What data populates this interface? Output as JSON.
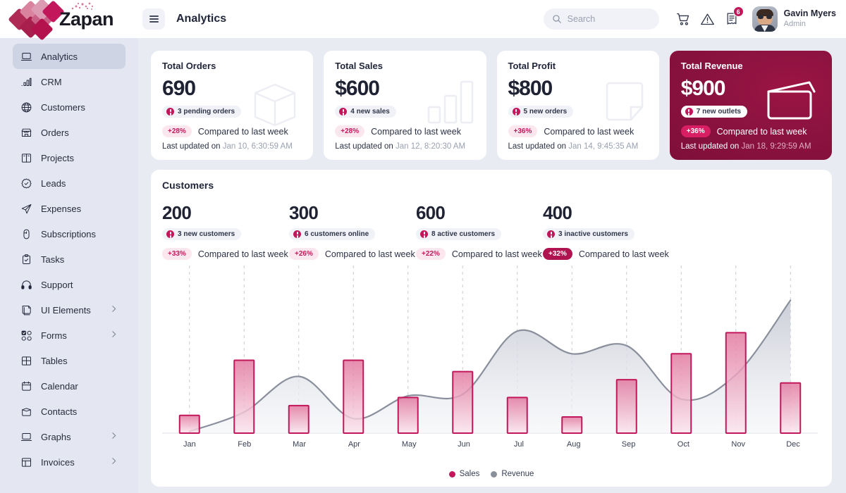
{
  "brand": {
    "name": "Zapan",
    "logo_icon": "diamond-grid-logo"
  },
  "header": {
    "menu_icon": "hamburger-icon",
    "title": "Analytics",
    "search": {
      "placeholder": "Search",
      "value": "",
      "icon": "search-icon"
    },
    "icons": [
      {
        "name": "cart-icon",
        "label": "Cart"
      },
      {
        "name": "alert-triangle-icon",
        "label": "Alerts"
      },
      {
        "name": "invoice-icon",
        "label": "Invoices",
        "badge": "6"
      }
    ],
    "user": {
      "name": "Gavin Myers",
      "role": "Admin",
      "avatar": "user-avatar"
    }
  },
  "sidebar": {
    "items": [
      {
        "label": "Analytics",
        "icon": "laptop-icon",
        "active": true,
        "expandable": false
      },
      {
        "label": "CRM",
        "icon": "bar-chart-icon",
        "active": false,
        "expandable": false
      },
      {
        "label": "Customers",
        "icon": "globe-icon",
        "active": false,
        "expandable": false
      },
      {
        "label": "Orders",
        "icon": "storefront-icon",
        "active": false,
        "expandable": false
      },
      {
        "label": "Projects",
        "icon": "kanban-icon",
        "active": false,
        "expandable": false
      },
      {
        "label": "Leads",
        "icon": "badge-check-icon",
        "active": false,
        "expandable": false
      },
      {
        "label": "Expenses",
        "icon": "paper-plane-icon",
        "active": false,
        "expandable": false
      },
      {
        "label": "Subscriptions",
        "icon": "mouse-icon",
        "active": false,
        "expandable": false
      },
      {
        "label": "Tasks",
        "icon": "clipboard-check-icon",
        "active": false,
        "expandable": false
      },
      {
        "label": "Support",
        "icon": "headset-icon",
        "active": false,
        "expandable": false
      },
      {
        "label": "UI Elements",
        "icon": "layers-icon",
        "active": false,
        "expandable": true
      },
      {
        "label": "Forms",
        "icon": "form-checkbox-icon",
        "active": false,
        "expandable": true
      },
      {
        "label": "Tables",
        "icon": "grid-table-icon",
        "active": false,
        "expandable": false
      },
      {
        "label": "Calendar",
        "icon": "calendar-icon",
        "active": false,
        "expandable": false
      },
      {
        "label": "Contacts",
        "icon": "contact-card-icon",
        "active": false,
        "expandable": false
      },
      {
        "label": "Graphs",
        "icon": "laptop-icon",
        "active": false,
        "expandable": true
      },
      {
        "label": "Invoices",
        "icon": "layout-panel-icon",
        "active": false,
        "expandable": true
      }
    ]
  },
  "kpis": [
    {
      "title": "Total Orders",
      "value": "690",
      "pill": "3 pending orders",
      "pct": "+28%",
      "compare": "Compared to last week",
      "updated_label": "Last updated on",
      "updated_time": "Jan 10, 6:30:59 AM",
      "art": "package-box-icon",
      "accent": false
    },
    {
      "title": "Total Sales",
      "value": "$600",
      "pill": "4 new sales",
      "pct": "+28%",
      "compare": "Compared to last week",
      "updated_label": "Last updated on",
      "updated_time": "Jan 12, 8:20:30 AM",
      "art": "bar-chart-icon",
      "accent": false
    },
    {
      "title": "Total Profit",
      "value": "$800",
      "pill": "5 new orders",
      "pct": "+36%",
      "compare": "Compared to last week",
      "updated_label": "Last updated on",
      "updated_time": "Jan 14, 9:45:35 AM",
      "art": "note-fold-icon",
      "accent": false
    },
    {
      "title": "Total Revenue",
      "value": "$900",
      "pill": "7 new outlets",
      "pct": "+36%",
      "compare": "Compared to last week",
      "updated_label": "Last updated on",
      "updated_time": "Jan 18, 9:29:59 AM",
      "art": "wallet-icon",
      "accent": true
    }
  ],
  "customers_panel": {
    "title": "Customers",
    "stats": [
      {
        "value": "200",
        "pill": "3 new customers",
        "pct": "+33%",
        "compare": "Compared to last week",
        "pct_solid": false
      },
      {
        "value": "300",
        "pill": "6 customers online",
        "pct": "+26%",
        "compare": "Compared to last week",
        "pct_solid": false
      },
      {
        "value": "600",
        "pill": "8 active customers",
        "pct": "+22%",
        "compare": "Compared to last week",
        "pct_solid": false
      },
      {
        "value": "400",
        "pill": "3 inactive customers",
        "pct": "+32%",
        "compare": "Compared to last week",
        "pct_solid": true
      }
    ]
  },
  "chart_data": {
    "type": "bar",
    "title": "Customers",
    "xlabel": "",
    "ylabel": "",
    "grid": "vertical-dashed",
    "legend_position": "bottom",
    "categories": [
      "Jan",
      "Feb",
      "Mar",
      "Apr",
      "May",
      "Jun",
      "Jul",
      "Aug",
      "Sep",
      "Oct",
      "Nov",
      "Dec"
    ],
    "ylim": [
      0,
      100
    ],
    "series": [
      {
        "name": "Sales",
        "type": "bar",
        "color": "#c2185b",
        "values": [
          11,
          45,
          17,
          45,
          22,
          38,
          22,
          10,
          33,
          49,
          62,
          31
        ]
      },
      {
        "name": "Revenue",
        "type": "area",
        "color": "#8a8f9c",
        "values": [
          1,
          13,
          35,
          9,
          23,
          24,
          63,
          49,
          54,
          21,
          36,
          82
        ]
      }
    ]
  },
  "colors": {
    "accent": "#c2185b",
    "accent_dark": "#8e1340",
    "page_bg": "#e9ebf3",
    "sidebar_bg": "#e4e7f1",
    "card_bg": "#ffffff",
    "revenue_gray": "#8a8f9c"
  }
}
